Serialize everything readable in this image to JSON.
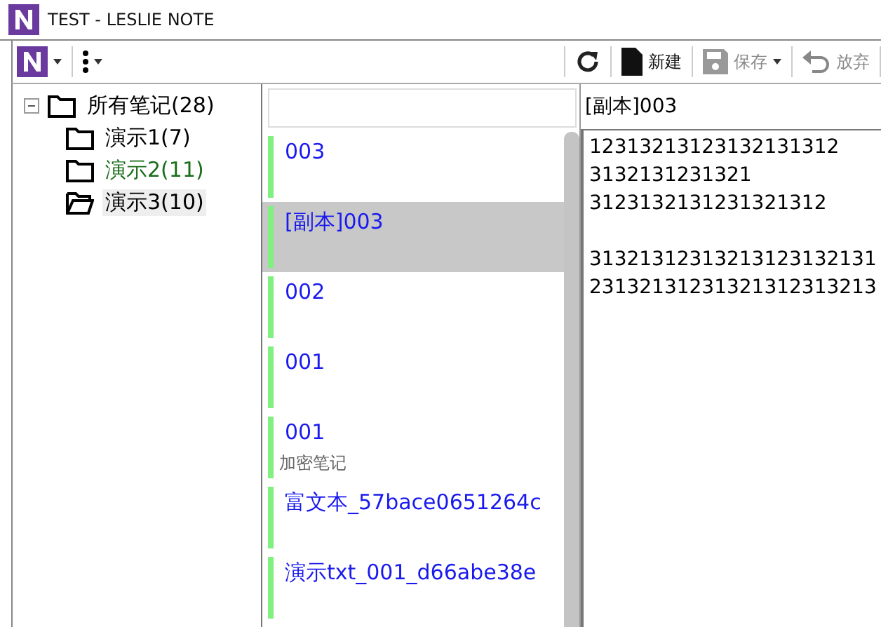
{
  "window": {
    "title": "TEST - LESLIE NOTE"
  },
  "toolbar": {
    "items": [
      {
        "kind": "refresh"
      },
      {
        "kind": "new",
        "label": "新建",
        "disabled": false
      },
      {
        "kind": "save",
        "label": "保存",
        "disabled": true
      },
      {
        "kind": "discard",
        "label": "放弃",
        "disabled": true
      }
    ]
  },
  "tree": {
    "items": [
      {
        "label": "所有笔记(28)",
        "expanded": true,
        "selected": false,
        "color": "#000000",
        "children": [
          {
            "label": "演示1(7)",
            "selected": false,
            "color": "#000000"
          },
          {
            "label": "演示2(11)",
            "selected": false,
            "color": "#1a6e1a"
          },
          {
            "label": "演示3(10)",
            "selected": true,
            "color": "#000000"
          }
        ]
      }
    ]
  },
  "notes": {
    "items": [
      {
        "title": "003",
        "selected": false
      },
      {
        "title": "[副本]003",
        "selected": true
      },
      {
        "title": "002",
        "selected": false
      },
      {
        "title": "001",
        "selected": false
      },
      {
        "title": "001",
        "subtitle": "加密笔记",
        "selected": false
      },
      {
        "title": "富文本_57bace0651264c",
        "selected": false
      },
      {
        "title": "演示txt_001_d66abe38e",
        "selected": false
      }
    ]
  },
  "editor": {
    "title": "[副本]003",
    "paragraphs": [
      [
        "12313213123132131312",
        "3132131231321",
        "3123132131231321312"
      ],
      [
        "31321312313213123132131",
        "23132131231321312313213"
      ]
    ]
  }
}
